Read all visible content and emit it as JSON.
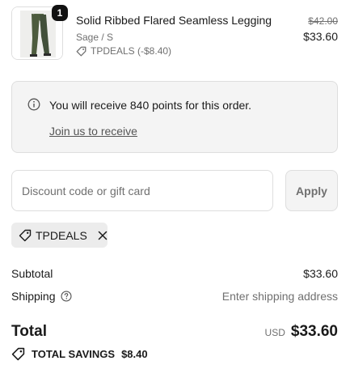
{
  "line_item": {
    "quantity": "1",
    "title": "Solid Ribbed Flared Seamless Legging",
    "variant": "Sage / S",
    "discount_text": "TPDEALS (-$8.40)",
    "original_price": "$42.00",
    "price": "$33.60",
    "image_icon": "legging-product-image"
  },
  "points": {
    "message": "You will receive 840 points for this order.",
    "link": "Join us to receive"
  },
  "discount": {
    "placeholder": "Discount code or gift card",
    "value": "",
    "apply_label": "Apply"
  },
  "applied_code": {
    "code": "TPDEALS"
  },
  "summary": {
    "subtotal_label": "Subtotal",
    "subtotal_value": "$33.60",
    "shipping_label": "Shipping",
    "shipping_value": "Enter shipping address",
    "total_label": "Total",
    "currency": "USD",
    "total_value": "$33.60",
    "savings_label": "TOTAL SAVINGS",
    "savings_value": "$8.40"
  },
  "colors": {
    "text": "#1a1a1a",
    "muted": "#707070",
    "border": "#dedede",
    "panel": "#f4f4f4",
    "product": "#4d5c3e"
  }
}
